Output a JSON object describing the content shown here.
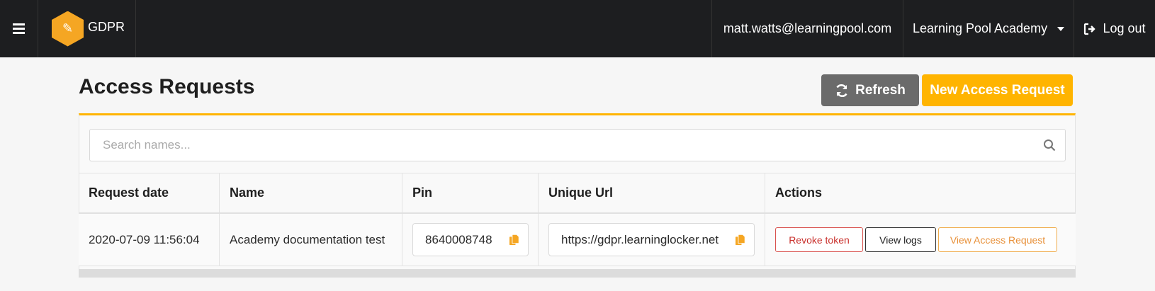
{
  "header": {
    "app_name": "GDPR",
    "logo_glyph": "✎",
    "user_email": "matt.watts@learningpool.com",
    "organisation": "Learning Pool Academy",
    "logout_label": "Log out"
  },
  "page": {
    "title": "Access Requests",
    "refresh_label": "Refresh",
    "new_request_label": "New Access Request"
  },
  "search": {
    "placeholder": "Search names...",
    "value": ""
  },
  "table": {
    "columns": [
      "Request date",
      "Name",
      "Pin",
      "Unique Url",
      "Actions"
    ],
    "rows": [
      {
        "request_date": "2020-07-09 11:56:04",
        "name": "Academy documentation test",
        "pin": "8640008748",
        "unique_url": "https://gdpr.learninglocker.net",
        "actions": [
          "Revoke token",
          "View logs",
          "View Access Request"
        ]
      }
    ]
  },
  "colors": {
    "accent": "#ffb400",
    "topbar": "#1d1e20",
    "refresh_button": "#6b6b6b",
    "danger": "#d9534f",
    "warning": "#f0ad4e"
  },
  "icons": {
    "menu": "hamburger-icon",
    "logo": "gdpr-hexagon-logo",
    "dropdown": "caret-down-icon",
    "logout": "sign-out-icon",
    "refresh": "sync-icon",
    "search": "search-icon",
    "copy": "copy-icon"
  }
}
